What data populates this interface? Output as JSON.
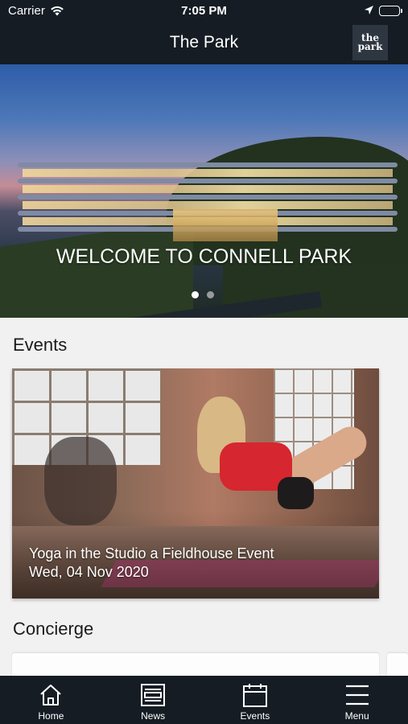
{
  "status_bar": {
    "carrier": "Carrier",
    "time": "7:05 PM"
  },
  "header": {
    "title": "The Park",
    "logo_line1": "the",
    "logo_line2": "park"
  },
  "hero": {
    "caption": "WELCOME TO CONNELL PARK",
    "slide_count": 2,
    "active_slide": 1
  },
  "events": {
    "heading": "Events",
    "items": [
      {
        "title": "Yoga in the Studio a Fieldhouse Event",
        "date": "Wed, 04 Nov 2020"
      }
    ]
  },
  "concierge": {
    "heading": "Concierge"
  },
  "tabs": [
    {
      "label": "Home",
      "icon": "home-icon"
    },
    {
      "label": "News",
      "icon": "news-icon"
    },
    {
      "label": "Events",
      "icon": "calendar-icon"
    },
    {
      "label": "Menu",
      "icon": "hamburger-menu-icon"
    }
  ],
  "colors": {
    "bar_background": "#151c24",
    "page_background": "#f2f1f1",
    "text": "#ffffff"
  }
}
